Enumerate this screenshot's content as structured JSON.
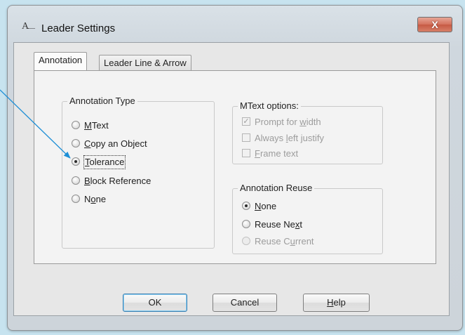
{
  "window": {
    "title": "Leader Settings",
    "close_glyph": "X",
    "app_icon": "autocad-text-icon",
    "icon_glyph": "A"
  },
  "tabs": [
    {
      "label": "Annotation",
      "active": true
    },
    {
      "label": "Leader Line & Arrow",
      "active": false
    }
  ],
  "annotation_type": {
    "legend": "Annotation Type",
    "options": [
      {
        "label": "MText",
        "accel": "M",
        "checked": false
      },
      {
        "label": "Copy an Object",
        "accel": "C",
        "checked": false
      },
      {
        "label": "Tolerance",
        "accel": "T",
        "checked": true
      },
      {
        "label": "Block Reference",
        "accel": "B",
        "checked": false
      },
      {
        "label": "None",
        "accel": "o",
        "checked": false
      }
    ]
  },
  "mtext_options": {
    "legend": "MText options:",
    "options": [
      {
        "label": "Prompt for width",
        "checked": true,
        "enabled": false
      },
      {
        "label": "Always left justify",
        "checked": false,
        "enabled": false
      },
      {
        "label": "Frame text",
        "checked": false,
        "enabled": false
      }
    ]
  },
  "annotation_reuse": {
    "legend": "Annotation Reuse",
    "options": [
      {
        "label": "None",
        "checked": true,
        "enabled": true
      },
      {
        "label": "Reuse Next",
        "checked": false,
        "enabled": true
      },
      {
        "label": "Reuse Current",
        "checked": false,
        "enabled": false
      }
    ]
  },
  "buttons": {
    "ok": "OK",
    "cancel": "Cancel",
    "help": "Help"
  },
  "colors": {
    "pointer_arrow": "#1e8fd6",
    "backdrop": "#c7e3ef",
    "close_button": "#d4715c"
  }
}
